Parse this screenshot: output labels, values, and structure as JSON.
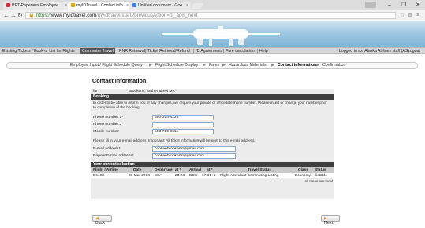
{
  "browser": {
    "tabs": [
      {
        "label": "PET-Paperless Employee",
        "active": false
      },
      {
        "label": "myIDTravel - Contact info",
        "active": true
      },
      {
        "label": "Untitled document - Goo",
        "active": false
      }
    ],
    "url_scheme": "https://",
    "url_host": "www.myidtravel.com",
    "url_path": "/myidtravel/start?previousAction=bl_apis_next",
    "win_min": "–",
    "win_max": "❐",
    "win_close": "✕"
  },
  "menu": {
    "items": [
      "Existing Tickets / Book or List for Flights",
      "Commuter Travel",
      "PNR Retrieval",
      "Ticket Retrieval/Refund",
      "ID Agreements",
      "Fare calculation",
      "Help"
    ],
    "active_index": 1,
    "logged_in": "Logged in as: Alaska Airlines staff (AS)",
    "logout": "Logout"
  },
  "steps": {
    "items": [
      "Employee Input / Flight Schedule Query",
      "Flight Schedule Display",
      "Fares",
      "Hazardous Materials",
      "Contact information",
      "Confirmation"
    ],
    "current_index": 4
  },
  "page": {
    "title": "Contact Information",
    "for_label": "for",
    "for_value": "Brookens, Seth Andrew MR",
    "booking_header": "Booking",
    "booking_note": "In order to be able to inform you of any changes, we require your private or office telephone number. Please insert or change your number prior to completion of the booking.",
    "phone1_label": "Phone number 1*",
    "phone1_value": "360-314-4225",
    "phone2_label": "Phone number 2",
    "phone2_value": "",
    "mobile_label": "Mobile number",
    "mobile_value": "503-729-9611",
    "email_note": "Please fill in your e-mail address. Important: All ticket information will be sent to this e-mail address.",
    "email_label": "E-mail address*",
    "email_value": "cookenbrookens@gmail.com",
    "repeat_email_label": "Repeat E-mail address*",
    "repeat_email_value": "cookenbrookens@gmail.com",
    "selection_header": "Your current selection",
    "columns": [
      "Flight / Airline",
      "Date",
      "Departure",
      "at *",
      "Arrival",
      "at *",
      "Travel Status",
      "Class",
      "Status"
    ],
    "row": [
      "B6498",
      "08 Mar 2016",
      "SEA",
      "23:23",
      "BOS",
      "07:31+1",
      "Flight Attendant Commuting Listing",
      "Economy",
      "listable"
    ],
    "footnote": "*all times are local",
    "back_label": "Back",
    "next_label": "Next"
  },
  "colors": {
    "menu_active": "#555555",
    "section_header": "#3f3f3f",
    "accent_arrow": "#f09a2c"
  }
}
